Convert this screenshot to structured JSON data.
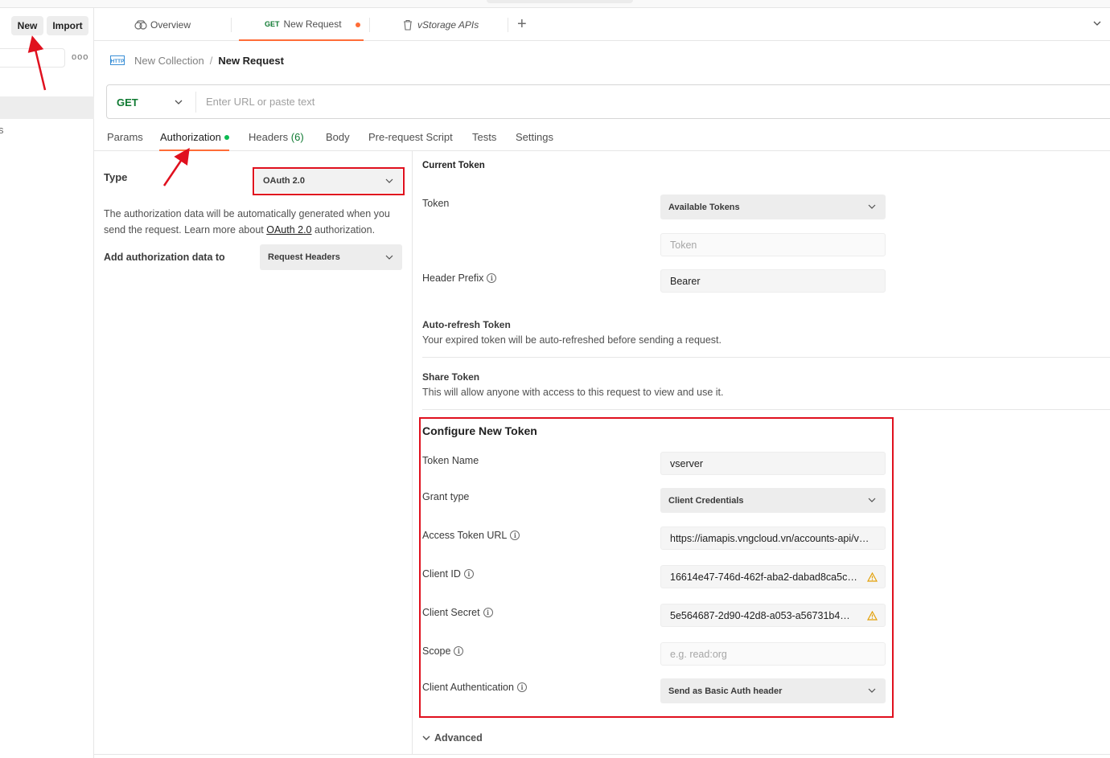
{
  "sidebar": {
    "new_label": "New",
    "import_label": "Import",
    "more_label": "ooo",
    "cut_text": "s"
  },
  "tabs": {
    "overview_label": "Overview",
    "new_request_method": "GET",
    "new_request_label": "New Request",
    "vstorage_label": "vStorage APIs",
    "plus_label": "+"
  },
  "breadcrumb": {
    "collection": "New Collection",
    "separator": "/",
    "request": "New Request"
  },
  "url_bar": {
    "method": "GET",
    "placeholder": "Enter URL or paste text"
  },
  "request_tabs": {
    "params": "Params",
    "authorization": "Authorization",
    "headers": "Headers",
    "headers_count": "(6)",
    "body": "Body",
    "pre_request": "Pre-request Script",
    "tests": "Tests",
    "settings": "Settings"
  },
  "auth": {
    "type_label": "Type",
    "type_value": "OAuth 2.0",
    "description_1": "The authorization data will be automatically generated when you send the request. Learn more about ",
    "description_link": "OAuth 2.0",
    "description_2": " authorization.",
    "add_to_label": "Add authorization data to",
    "add_to_value": "Request Headers"
  },
  "current_token": {
    "heading": "Current Token",
    "token_label": "Token",
    "available_tokens": "Available Tokens",
    "token_placeholder": "Token",
    "header_prefix_label": "Header Prefix",
    "header_prefix_value": "Bearer",
    "auto_refresh_title": "Auto-refresh Token",
    "auto_refresh_desc": "Your expired token will be auto-refreshed before sending a request.",
    "share_title": "Share Token",
    "share_desc": "This will allow anyone with access to this request to view and use it."
  },
  "configure": {
    "heading": "Configure New Token",
    "token_name_label": "Token Name",
    "token_name_value": "vserver",
    "grant_type_label": "Grant type",
    "grant_type_value": "Client Credentials",
    "access_token_url_label": "Access Token URL",
    "access_token_url_value": "https://iamapis.vngcloud.vn/accounts-api/v…",
    "client_id_label": "Client ID",
    "client_id_value": "16614e47-746d-462f-aba2-dabad8ca5c…",
    "client_secret_label": "Client Secret",
    "client_secret_value": "5e564687-2d90-42d8-a053-a56731b4…",
    "scope_label": "Scope",
    "scope_placeholder": "e.g. read:org",
    "client_auth_label": "Client Authentication",
    "client_auth_value": "Send as Basic Auth header",
    "advanced_label": "Advanced"
  },
  "icons": {
    "overview": "overview-icon",
    "trash": "trash-icon",
    "http": "http-icon",
    "chevron": "chevron-down-icon",
    "info": "info-icon",
    "warning": "warning-icon"
  },
  "colors": {
    "accent": "#ff6c37",
    "method_get": "#0f7a32",
    "status_dot": "#0cbb52",
    "annotation": "#e0101e",
    "warning": "#e3a008"
  }
}
